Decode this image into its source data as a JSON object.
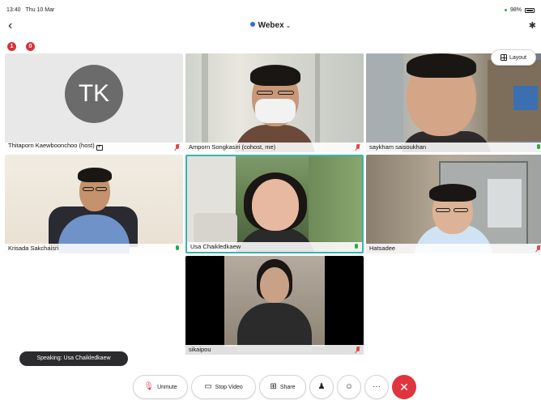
{
  "status_bar": {
    "time": "13:40",
    "date": "Thu 10 Mar",
    "battery": "98%"
  },
  "header": {
    "title": "Webex",
    "title_chevron": "⌄",
    "back_glyph": "‹",
    "bluetooth_glyph": "✱"
  },
  "badges": [
    "1",
    "0"
  ],
  "layout_button": {
    "label": "Layout"
  },
  "participants": [
    {
      "name": "Thitaporn Kaewboonchoo (host)",
      "initials": "TK",
      "mic": "muted"
    },
    {
      "name": "Amporn Songkasiri (cohost, me)",
      "mic": "muted"
    },
    {
      "name": "saykham saisoukhan",
      "mic": "live"
    },
    {
      "name": "Krisada Sakchaisri",
      "mic": "live"
    },
    {
      "name": "Usa Chaikledkaew",
      "mic": "live"
    },
    {
      "name": "Hatsadee",
      "mic": "muted"
    },
    {
      "name": "sikaipou",
      "mic": "muted"
    }
  ],
  "speaking_indicator": "Speaking: Usa Chaikledkaew",
  "toolbar": {
    "unmute": "Unmute",
    "stop_video": "Stop Video",
    "share": "Share",
    "participants_glyph": "♟",
    "reactions_glyph": "☺",
    "more_glyph": "···",
    "end_glyph": "✕"
  },
  "icons": [
    "back-icon",
    "bluetooth-icon",
    "layout-icon",
    "mic-icon",
    "camera-icon",
    "share-icon",
    "participants-icon",
    "reactions-icon",
    "more-icon",
    "end-call-icon"
  ],
  "colors": {
    "end_call": "#e0353e",
    "muted": "#e04850",
    "live": "#2aa84a",
    "active_speaker": "#3ab5b0",
    "brand": "#2b72d8"
  }
}
